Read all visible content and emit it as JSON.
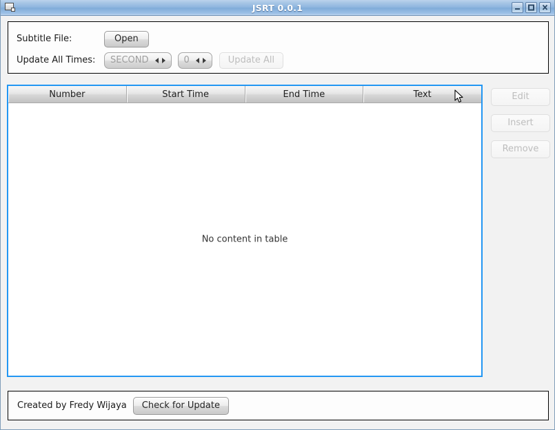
{
  "window": {
    "title": "JSRT 0.0.1",
    "icon": "window-app-icon",
    "controls": {
      "minimize": "minimize",
      "maximize": "maximize",
      "close": "close"
    },
    "accent_color": "#2196f3",
    "titlebar_color": "#8cb4de"
  },
  "top_panel": {
    "subtitle_file_label": "Subtitle File:",
    "open_button": "Open",
    "update_all_times_label": "Update All Times:",
    "unit_spinner_value": "SECOND",
    "amount_spinner_value": "0",
    "update_all_button": "Update All"
  },
  "table": {
    "columns": [
      {
        "label": "Number"
      },
      {
        "label": "Start Time"
      },
      {
        "label": "End Time"
      },
      {
        "label": "Text"
      }
    ],
    "rows": [],
    "empty_message": "No content in table"
  },
  "side_actions": {
    "edit": "Edit",
    "insert": "Insert",
    "remove": "Remove"
  },
  "footer": {
    "credit": "Created by Fredy Wijaya",
    "check_update_button": "Check for Update"
  }
}
